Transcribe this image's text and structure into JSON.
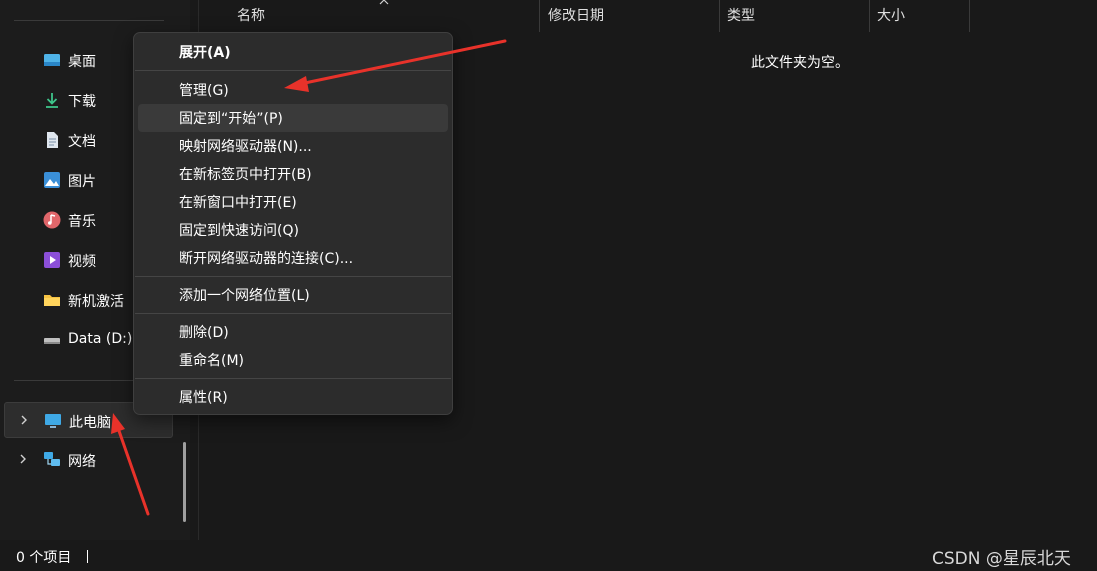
{
  "sidebar": {
    "items": [
      {
        "label": "桌面",
        "icon": "desktop-icon"
      },
      {
        "label": "下载",
        "icon": "download-icon"
      },
      {
        "label": "文档",
        "icon": "document-icon"
      },
      {
        "label": "图片",
        "icon": "picture-icon"
      },
      {
        "label": "音乐",
        "icon": "music-icon"
      },
      {
        "label": "视频",
        "icon": "video-icon"
      },
      {
        "label": "新机激活",
        "icon": "folder-icon"
      },
      {
        "label": "Data (D:)",
        "icon": "drive-icon"
      }
    ],
    "this_pc": "此电脑",
    "network": "网络"
  },
  "columns": {
    "name": "名称",
    "modified": "修改日期",
    "type": "类型",
    "size": "大小"
  },
  "empty_message": "此文件夹为空。",
  "status": {
    "count": "0 个项目"
  },
  "watermark": "CSDN @星辰北天",
  "context_menu": {
    "expand": "展开(A)",
    "manage": "管理(G)",
    "pin_start": "固定到“开始”(P)",
    "map_drive": "映射网络驱动器(N)...",
    "open_tab": "在新标签页中打开(B)",
    "open_window": "在新窗口中打开(E)",
    "pin_quick": "固定到快速访问(Q)",
    "disconnect": "断开网络驱动器的连接(C)...",
    "add_location": "添加一个网络位置(L)",
    "delete": "删除(D)",
    "rename": "重命名(M)",
    "properties": "属性(R)"
  },
  "colors": {
    "background": "#191919",
    "menu": "#2c2c2c",
    "arrow": "#e8322a"
  }
}
